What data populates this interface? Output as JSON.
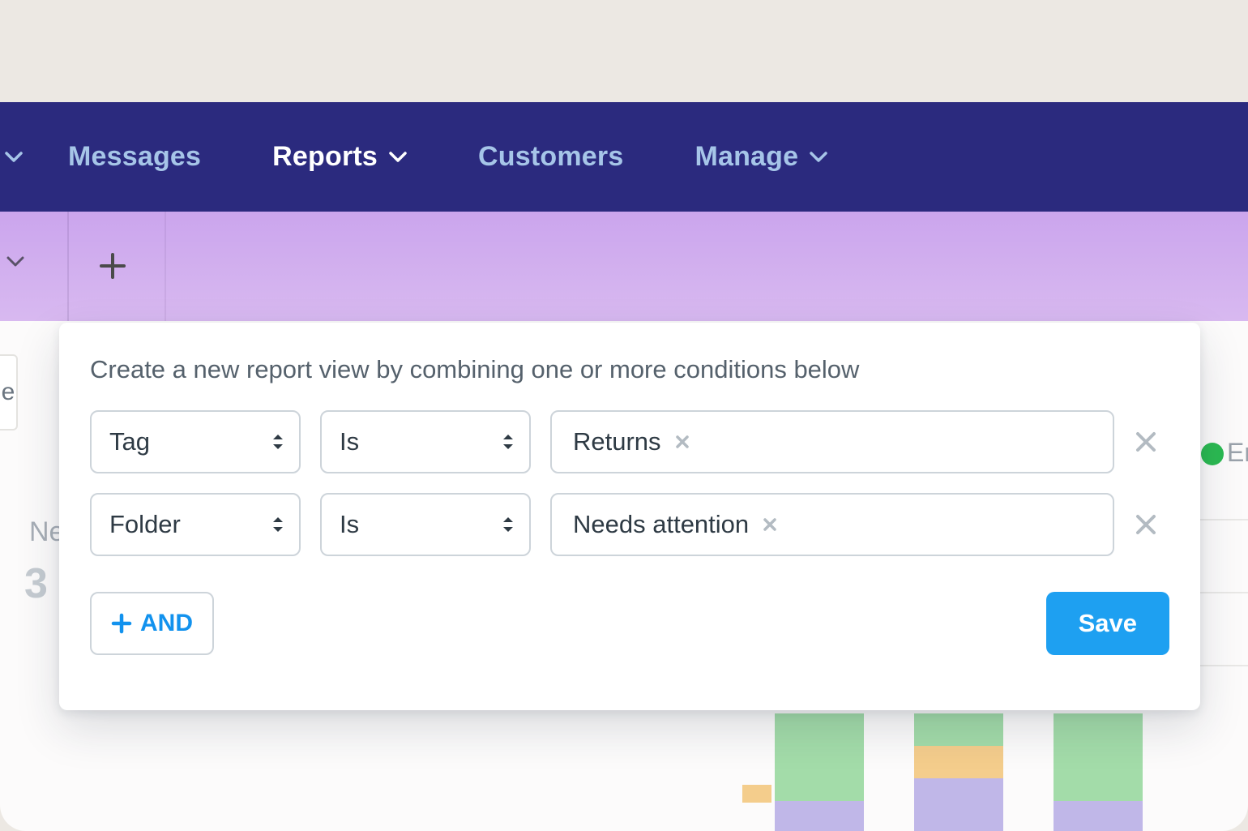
{
  "nav": {
    "items": [
      {
        "label": "Messages",
        "has_caret": false,
        "active": false
      },
      {
        "label": "Reports",
        "has_caret": true,
        "active": true
      },
      {
        "label": "Customers",
        "has_caret": false,
        "active": false
      },
      {
        "label": "Manage",
        "has_caret": true,
        "active": false
      }
    ]
  },
  "panel": {
    "description": "Create a new report view by combining one or more conditions below",
    "conditions": [
      {
        "field": "Tag",
        "operator": "Is",
        "value": "Returns"
      },
      {
        "field": "Folder",
        "operator": "Is",
        "value": "Needs attention"
      }
    ],
    "add_and_label": "AND",
    "save_label": "Save"
  },
  "background": {
    "left_tab_char": "e",
    "new_label": "Ne",
    "big_number": "3",
    "status_fragment": "Er"
  },
  "colors": {
    "navbar_bg": "#2b2a7e",
    "nav_text": "#a6c5e8",
    "nav_active": "#ffffff",
    "subbar_bg_top": "#cba5ed",
    "accent_blue": "#1292ee",
    "save_blue": "#1ea0f1",
    "border_gray": "#cdd4da"
  }
}
